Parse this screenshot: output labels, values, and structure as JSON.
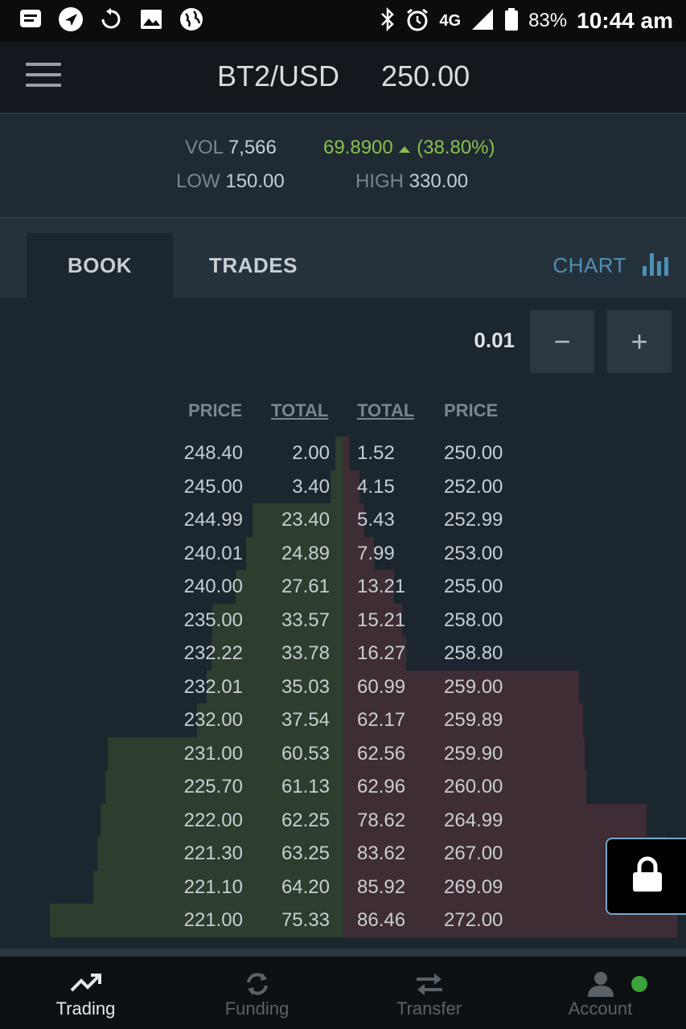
{
  "status_bar": {
    "battery_pct": "83%",
    "time": "10:44 am",
    "network": "4G",
    "icons": [
      "notification-icon",
      "navigation-icon",
      "sync-icon",
      "image-icon",
      "globe-icon",
      "bluetooth-icon",
      "alarm-icon",
      "signal-icon",
      "battery-icon"
    ]
  },
  "header": {
    "pair": "BT2/USD",
    "last_price": "250.00"
  },
  "stats": {
    "vol_label": "VOL",
    "vol_value": "7,566",
    "change": "69.8900",
    "change_pct": "(38.80%)",
    "low_label": "LOW",
    "low_value": "150.00",
    "high_label": "HIGH",
    "high_value": "330.00"
  },
  "tabs": {
    "book": "BOOK",
    "trades": "TRADES",
    "chart": "CHART"
  },
  "orderbook": {
    "step": "0.01",
    "minus": "−",
    "plus": "+",
    "headers": [
      "PRICE",
      "TOTAL",
      "TOTAL",
      "PRICE"
    ],
    "rows": [
      {
        "bid_price": "248.40",
        "bid_total": "2.00",
        "ask_total": "1.52",
        "ask_price": "250.00"
      },
      {
        "bid_price": "245.00",
        "bid_total": "3.40",
        "ask_total": "4.15",
        "ask_price": "252.00"
      },
      {
        "bid_price": "244.99",
        "bid_total": "23.40",
        "ask_total": "5.43",
        "ask_price": "252.99"
      },
      {
        "bid_price": "240.01",
        "bid_total": "24.89",
        "ask_total": "7.99",
        "ask_price": "253.00"
      },
      {
        "bid_price": "240.00",
        "bid_total": "27.61",
        "ask_total": "13.21",
        "ask_price": "255.00"
      },
      {
        "bid_price": "235.00",
        "bid_total": "33.57",
        "ask_total": "15.21",
        "ask_price": "258.00"
      },
      {
        "bid_price": "232.22",
        "bid_total": "33.78",
        "ask_total": "16.27",
        "ask_price": "258.80"
      },
      {
        "bid_price": "232.01",
        "bid_total": "35.03",
        "ask_total": "60.99",
        "ask_price": "259.00"
      },
      {
        "bid_price": "232.00",
        "bid_total": "37.54",
        "ask_total": "62.17",
        "ask_price": "259.89"
      },
      {
        "bid_price": "231.00",
        "bid_total": "60.53",
        "ask_total": "62.56",
        "ask_price": "259.90"
      },
      {
        "bid_price": "225.70",
        "bid_total": "61.13",
        "ask_total": "62.96",
        "ask_price": "260.00"
      },
      {
        "bid_price": "222.00",
        "bid_total": "62.25",
        "ask_total": "78.62",
        "ask_price": "264.99"
      },
      {
        "bid_price": "221.30",
        "bid_total": "63.25",
        "ask_total": "83.62",
        "ask_price": "267.00"
      },
      {
        "bid_price": "221.10",
        "bid_total": "64.20",
        "ask_total": "85.92",
        "ask_price": "269.09"
      },
      {
        "bid_price": "221.00",
        "bid_total": "75.33",
        "ask_total": "86.46",
        "ask_price": "272.00"
      }
    ]
  },
  "nav": [
    {
      "label": "Trading",
      "icon": "trending-up-icon",
      "active": true
    },
    {
      "label": "Funding",
      "icon": "refresh-icon",
      "active": false
    },
    {
      "label": "Transfer",
      "icon": "transfer-arrows-icon",
      "active": false
    },
    {
      "label": "Account",
      "icon": "user-icon",
      "active": false
    }
  ],
  "colors": {
    "bid_bar": "#2d3d2e",
    "ask_bar": "#3f2d35",
    "change_green": "#8bbf4c",
    "chart_link": "#4d8fb5",
    "online_dot": "#3aa33a"
  }
}
